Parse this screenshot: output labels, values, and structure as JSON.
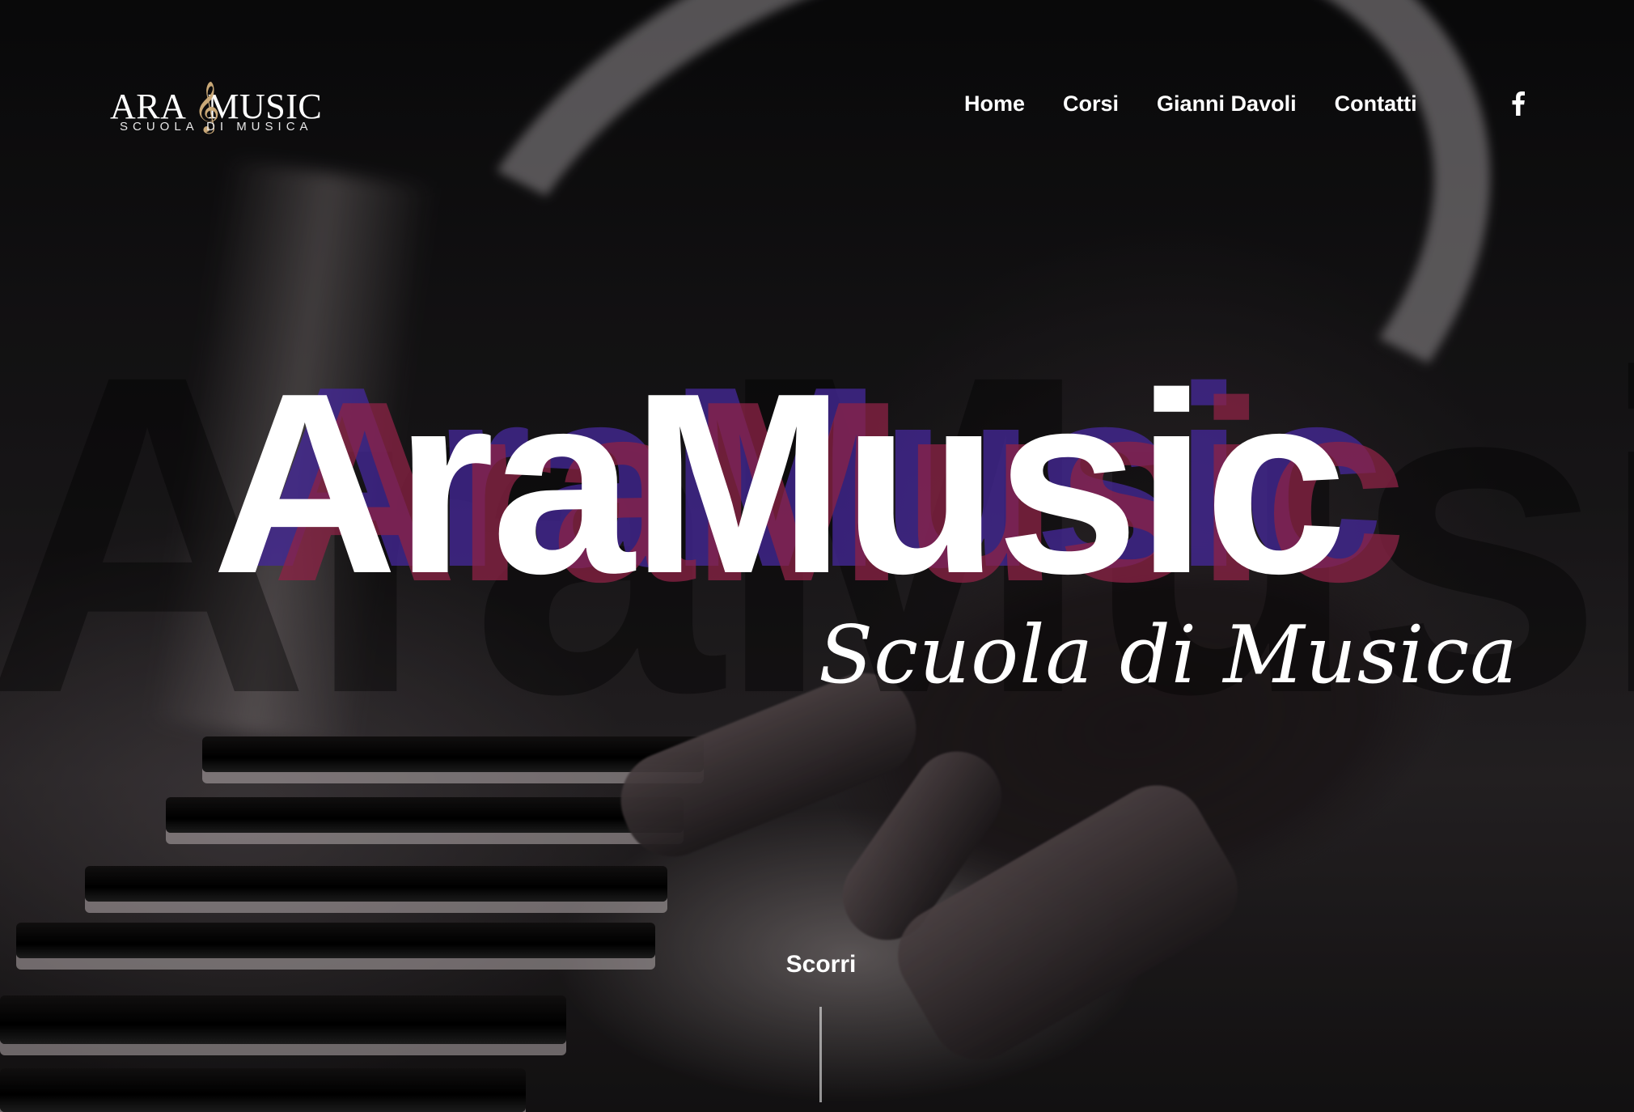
{
  "logo": {
    "name_left": "ARA",
    "name_right": "MUSIC",
    "clef_glyph": "𝄞",
    "tagline": "SCUOLA DI MUSICA"
  },
  "nav": {
    "items": [
      {
        "label": "Home"
      },
      {
        "label": "Corsi"
      },
      {
        "label": "Gianni Davoli"
      },
      {
        "label": "Contatti"
      }
    ]
  },
  "social": {
    "facebook_glyph": "f",
    "icon": "facebook-icon"
  },
  "hero": {
    "title": "AraMusic",
    "ghost_text": "AraMusic",
    "subtitle": "Scuola di Musica",
    "scroll_label": "Scorri"
  },
  "colors": {
    "title": "#ffffff",
    "shadow_blue": "#44289a",
    "shadow_red": "#8c2346",
    "clef": "#c9a877"
  }
}
